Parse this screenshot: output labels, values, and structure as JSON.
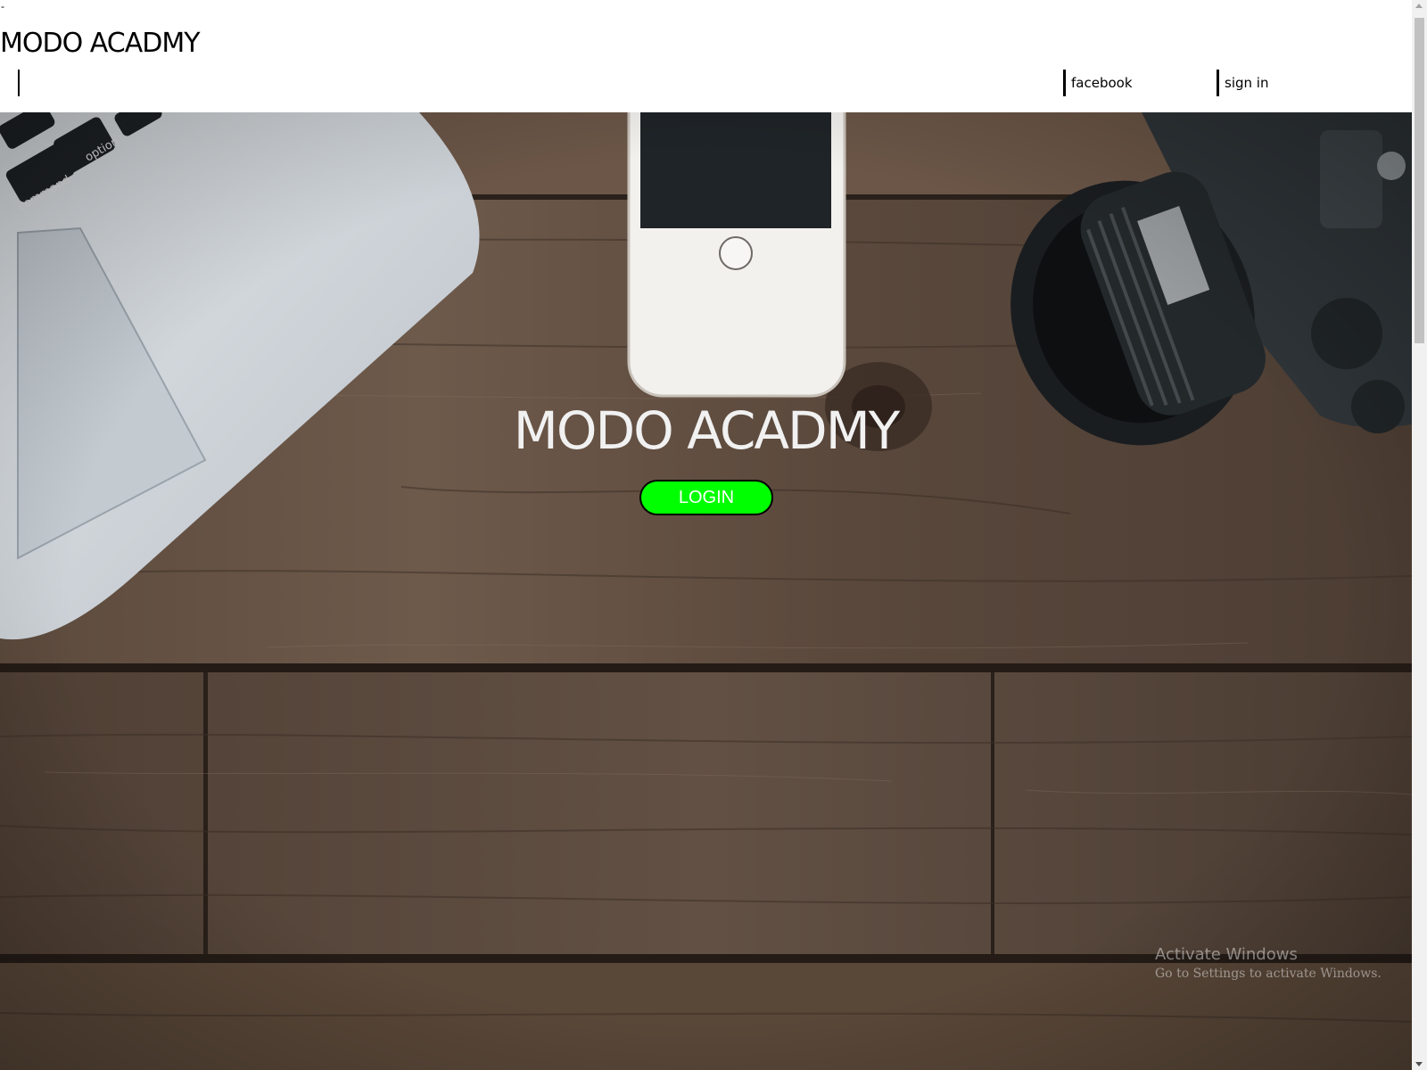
{
  "header": {
    "top_dash": "-",
    "logo_text": "MODO ACADMY",
    "nav": {
      "facebook_label": "facebook",
      "signin_label": "sign in"
    }
  },
  "hero": {
    "title": "MODO ACADMY",
    "login_label": "LOGIN",
    "login_color": "#00ff00",
    "background": "wooden desk with laptop, smartphone and camera"
  },
  "overlay": {
    "activate_title": "Activate Windows",
    "activate_sub": "Go to Settings to activate Windows."
  }
}
